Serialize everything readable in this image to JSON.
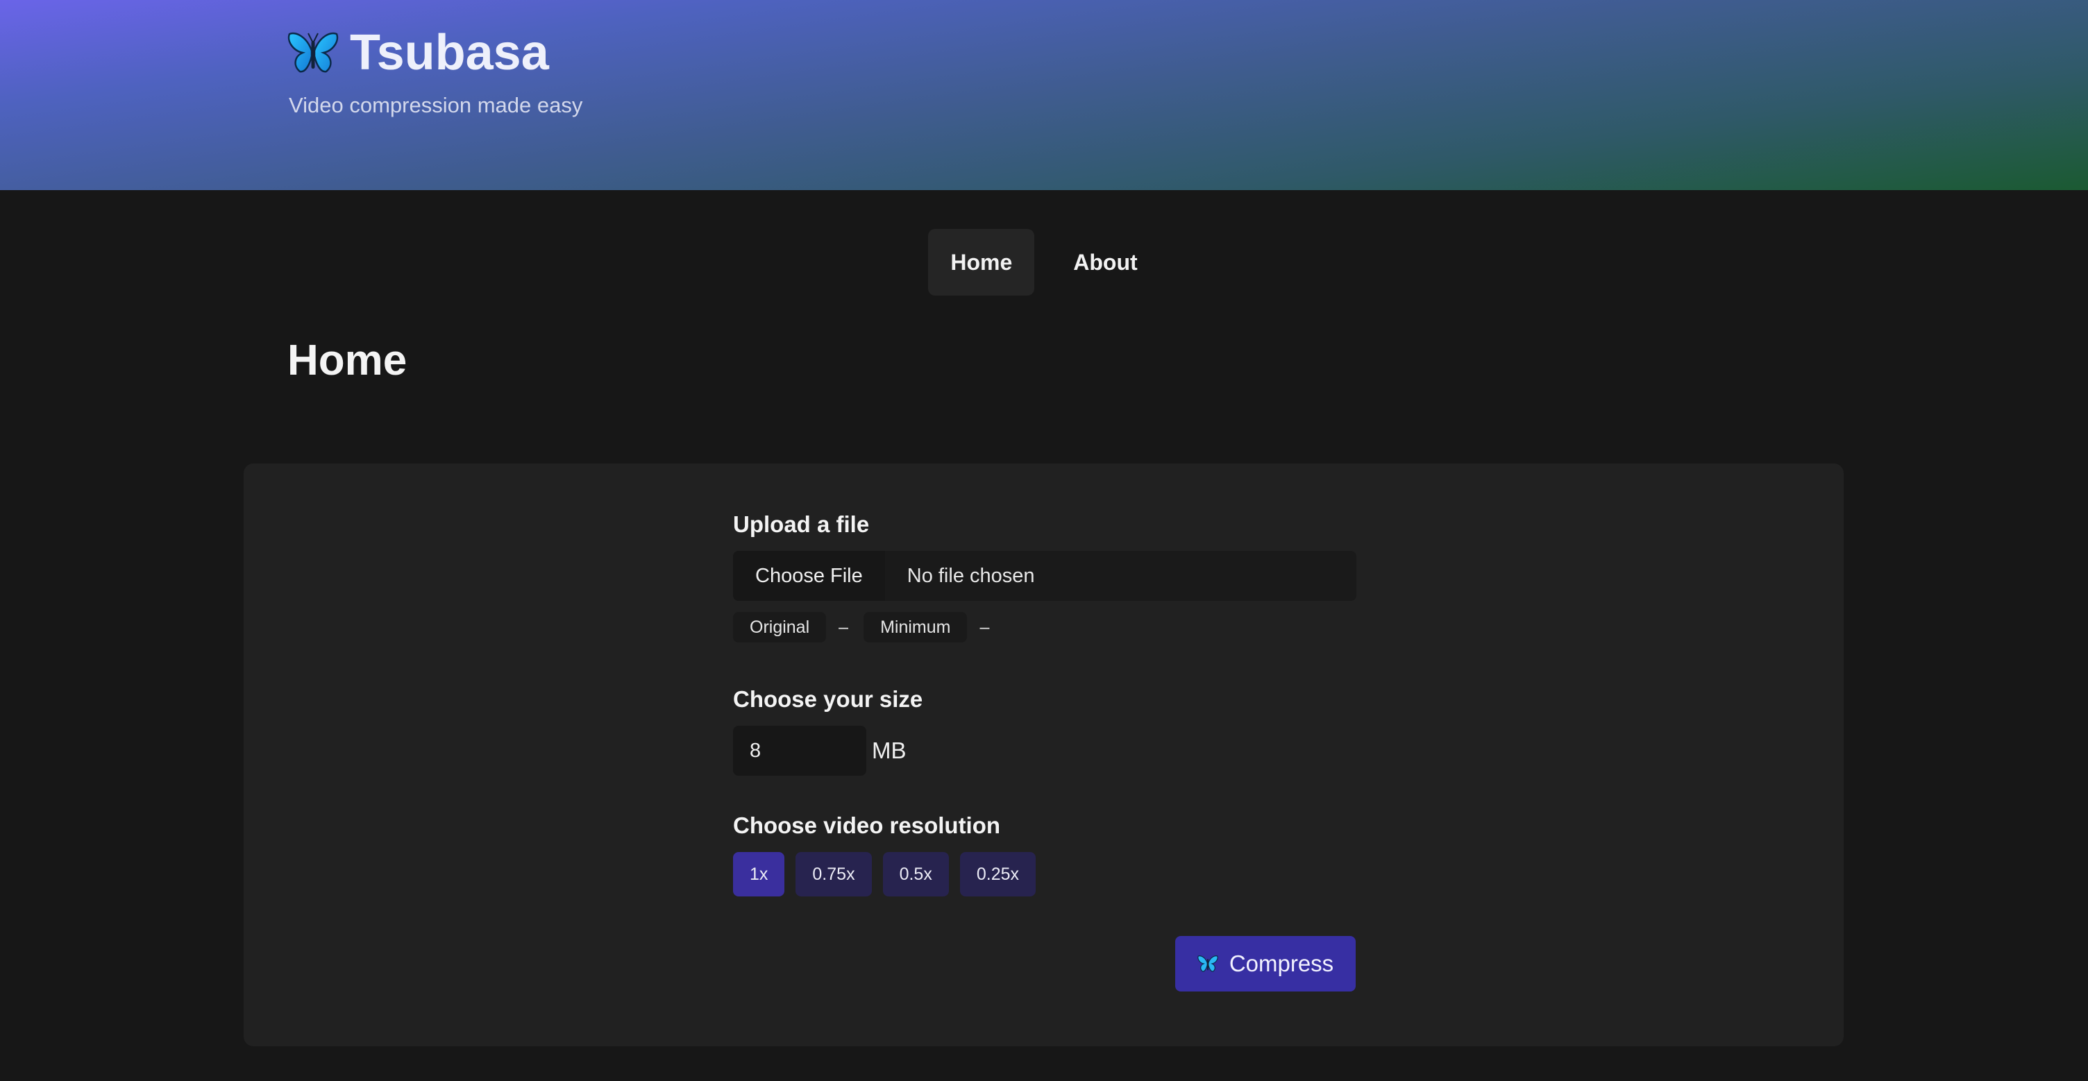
{
  "header": {
    "logo_icon": "butterfly-icon",
    "title": "Tsubasa",
    "tagline": "Video compression made easy"
  },
  "nav": {
    "items": [
      {
        "label": "Home",
        "active": true
      },
      {
        "label": "About",
        "active": false
      }
    ]
  },
  "page": {
    "title": "Home"
  },
  "upload": {
    "label": "Upload a file",
    "button_label": "Choose File",
    "status": "No file chosen",
    "original_label": "Original",
    "original_value": "–",
    "minimum_label": "Minimum",
    "minimum_value": "–"
  },
  "size": {
    "label": "Choose your size",
    "value": "8",
    "unit": "MB"
  },
  "resolution": {
    "label": "Choose video resolution",
    "options": [
      {
        "label": "1x",
        "selected": true
      },
      {
        "label": "0.75x",
        "selected": false
      },
      {
        "label": "0.5x",
        "selected": false
      },
      {
        "label": "0.25x",
        "selected": false
      }
    ]
  },
  "action": {
    "compress_label": "Compress",
    "compress_icon": "butterfly-icon"
  },
  "colors": {
    "accent": "#372fa3",
    "accent_selected": "#3a2f9e",
    "option_bg": "#27234f",
    "background": "#171717",
    "card": "#212121",
    "header_gradient_start": "#6a64e8",
    "header_gradient_end": "#1b5a32"
  }
}
